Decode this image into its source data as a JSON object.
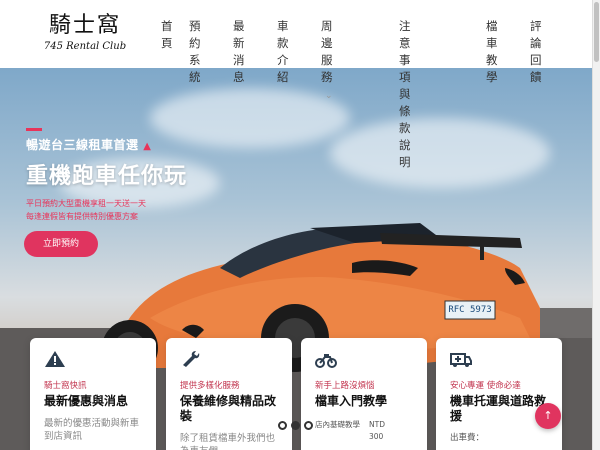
{
  "logo": {
    "title": "騎士窩",
    "subtitle": "745 Rental Club"
  },
  "nav": [
    {
      "line1": "首",
      "line2": "頁"
    },
    {
      "line1": "預約",
      "line2": "系統"
    },
    {
      "line1": "最新",
      "line2": "消息"
    },
    {
      "line1": "車款",
      "line2": "介紹"
    },
    {
      "line1": "周邊服務",
      "line2": ""
    },
    {
      "line1": "注意事項與",
      "line2": "條款說明"
    },
    {
      "line1": "檔車",
      "line2": "教學"
    },
    {
      "line1": "評論",
      "line2": "回饋"
    }
  ],
  "hero": {
    "kicker": "暢遊台三線租車首選",
    "title": "重機跑車任你玩",
    "desc1": "平日預約大型重機享租一天送一天",
    "desc2": "每逢連假皆有提供特別優惠方案",
    "button": "立即預約",
    "plate": "RFC 5973"
  },
  "cards": [
    {
      "icon": "warning-icon",
      "sub": "騎士窩快訊",
      "title": "最新優惠與消息",
      "text": "最新的優惠活動與新車到店資訊"
    },
    {
      "icon": "wrench-icon",
      "sub": "提供多樣化服務",
      "title": "保養維修與精品改裝",
      "text": "除了租賃檔車外我們也為車友們"
    },
    {
      "icon": "motorcycle-icon",
      "sub": "新手上路沒煩惱",
      "title": "檔車入門教學",
      "price_label": "店內基礎教學",
      "price_unit": "NTD",
      "price_value": "300"
    },
    {
      "icon": "ambulance-icon",
      "sub": "安心專運 使命必達",
      "title": "機車托運與道路救援",
      "text": "出車費："
    }
  ],
  "fab_label": "↑",
  "colors": {
    "accent": "#e0345f"
  }
}
